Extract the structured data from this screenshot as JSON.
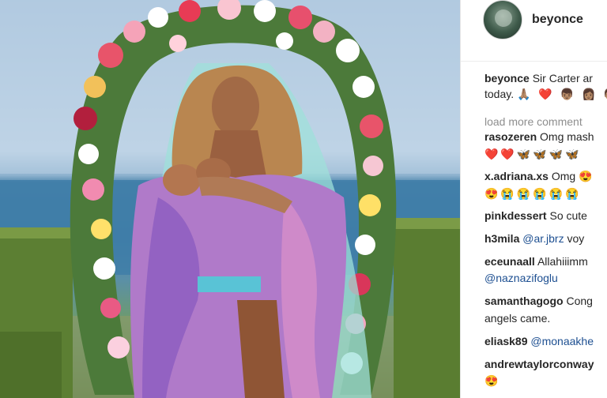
{
  "post": {
    "username": "beyonce",
    "caption_user": "beyonce",
    "caption_text": "Sir Carter ar",
    "caption_line2": "today.",
    "caption_emoji": "🙏🏽 ❤️ 👦🏽 👩🏽 👦🏽"
  },
  "comments": {
    "load_more": "load more comment",
    "items": [
      {
        "user": "rasozeren",
        "text": "Omg mash",
        "line2": "❤️❤️🦋🦋🦋🦋"
      },
      {
        "user": "x.adriana.xs",
        "text": "Omg",
        "trailing_emoji": "😍",
        "line2": "😍😭😭😭😭😭"
      },
      {
        "user": "pinkdessert",
        "text": "So cute"
      },
      {
        "user": "h3mila",
        "mention": "@ar.jbrz",
        "text": "voy"
      },
      {
        "user": "eceunaall",
        "text": "Allahiiimm",
        "line2_mention": "@naznazifoglu"
      },
      {
        "user": "samanthagogo",
        "text": "Cong",
        "line2": "angels came."
      },
      {
        "user": "eliask89",
        "mention": "@monaakhe"
      },
      {
        "user": "andrewtaylorconway",
        "line2": "😍"
      }
    ]
  },
  "photo": {
    "icons": [
      "flower-arch-icon",
      "woman-figure-icon",
      "baby-icon",
      "hedge-icon"
    ]
  }
}
